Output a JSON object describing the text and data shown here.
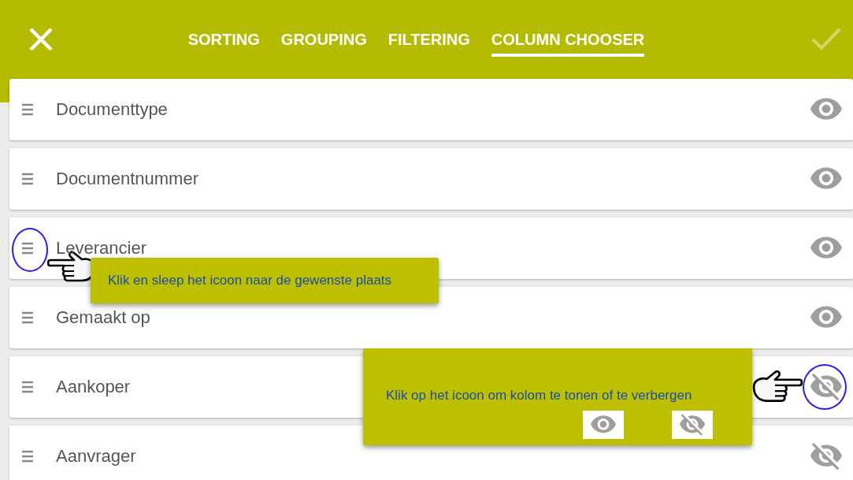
{
  "header": {
    "tabs": [
      {
        "label": "SORTING",
        "selected": false
      },
      {
        "label": "GROUPING",
        "selected": false
      },
      {
        "label": "FILTERING",
        "selected": false
      },
      {
        "label": "COLUMN CHOOSER",
        "selected": true
      }
    ],
    "confirm": {
      "disabled": true
    }
  },
  "columns": [
    {
      "label": "Documenttype",
      "visible": true
    },
    {
      "label": "Documentnummer",
      "visible": true
    },
    {
      "label": "Leverancier",
      "visible": true
    },
    {
      "label": "Gemaakt op",
      "visible": true
    },
    {
      "label": "Aankoper",
      "visible": false
    },
    {
      "label": "Aanvrager",
      "visible": false
    }
  ],
  "tooltips": [
    {
      "text": "Klik en sleep het icoon naar de gewenste plaats",
      "kind": "drag"
    },
    {
      "text": "Klik op het icoon om kolom te tonen of te verbergen",
      "kind": "visibility",
      "examples": [
        {
          "visible": true
        },
        {
          "visible": false
        }
      ]
    }
  ]
}
